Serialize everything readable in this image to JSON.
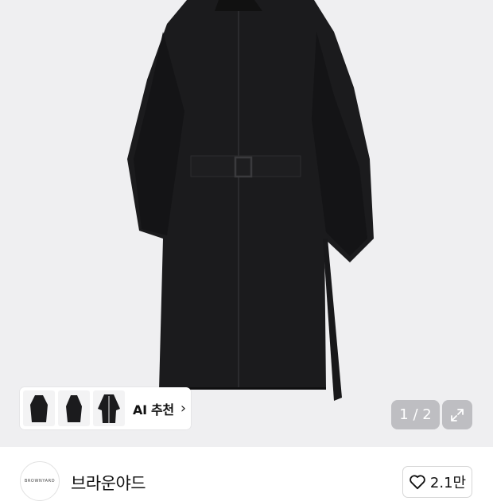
{
  "product_image": {
    "description_icon": "coat-image",
    "background": "#efeff1"
  },
  "ai_recommend": {
    "label": "AI 추천",
    "chevron": "›",
    "thumbnails": [
      "coat-thumb-front",
      "coat-thumb-side",
      "coat-thumb-back"
    ]
  },
  "gallery": {
    "pager_text": "1 / 2",
    "expand_icon": "expand-icon"
  },
  "brand": {
    "logo_text": "BROWNYARD",
    "name": "브라운야드",
    "likes": "2.1만"
  },
  "colors": {
    "coat": "#1a1a1c",
    "overlay": "rgba(150,150,155,0.55)"
  }
}
